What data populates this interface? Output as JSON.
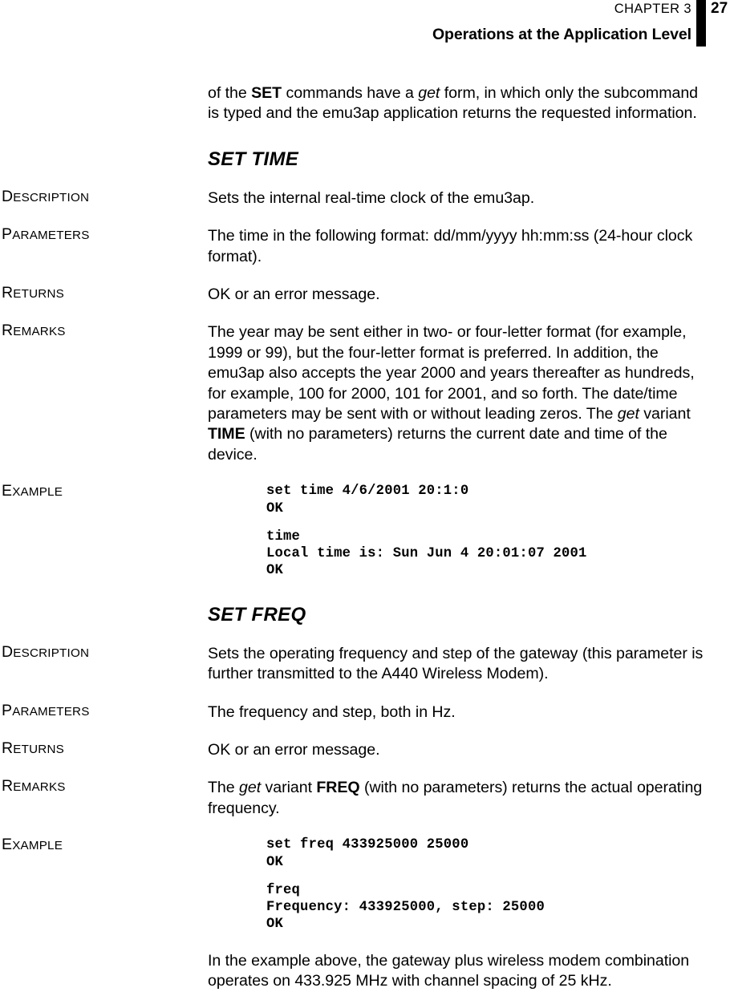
{
  "header": {
    "chapter_label": "CHAPTER 3",
    "page_number": "27",
    "running_title": "Operations at the Application Level"
  },
  "intro": {
    "text": "of the SET commands have a get form, in which only the subcommand is typed and the emu3ap application returns the requested information.",
    "segments": [
      {
        "text": "of the ",
        "style": "normal"
      },
      {
        "text": "SET",
        "style": "bold"
      },
      {
        "text": " commands have a ",
        "style": "normal"
      },
      {
        "text": "get",
        "style": "italic"
      },
      {
        "text": " form, in which only the subcommand is typed and the emu3ap application returns the requested information.",
        "style": "normal"
      }
    ]
  },
  "sections": [
    {
      "heading": "SET TIME",
      "labels": {
        "description": {
          "cap": "D",
          "rest": "ESCRIPTION"
        },
        "parameters": {
          "cap": "P",
          "rest": "ARAMETERS"
        },
        "returns": {
          "cap": "R",
          "rest": "ETURNS"
        },
        "remarks": {
          "cap": "R",
          "rest": "EMARKS"
        },
        "example": {
          "cap": "E",
          "rest": "XAMPLE"
        }
      },
      "description": "Sets the internal real-time clock of the emu3ap.",
      "parameters": "The time in the following format: dd/mm/yyyy hh:mm:ss (24-hour clock format).",
      "returns": "OK or an error message.",
      "remarks_part1": "The year may be sent either in two- or four-letter format (for example, 1999 or 99), but the four-letter format is preferred. In addition, the emu3ap also accepts the year 2000 and years thereafter as hundreds, for example, 100 for 2000, 101 for 2001, and so forth. The date/time parameters may be sent with or without leading zeros. The ",
      "remarks_italic": "get",
      "remarks_part2": " variant ",
      "remarks_bold": "TIME",
      "remarks_part3": " (with no parameters) returns the current date and time of the device.",
      "example_block_1": "set time 4/6/2001 20:1:0\nOK",
      "example_block_2": "time\nLocal time is: Sun Jun 4 20:01:07 2001\nOK"
    },
    {
      "heading": "SET FREQ",
      "labels": {
        "description": {
          "cap": "D",
          "rest": "ESCRIPTION"
        },
        "parameters": {
          "cap": "P",
          "rest": "ARAMETERS"
        },
        "returns": {
          "cap": "R",
          "rest": "ETURNS"
        },
        "remarks": {
          "cap": "R",
          "rest": "EMARKS"
        },
        "example": {
          "cap": "E",
          "rest": "XAMPLE"
        }
      },
      "description": "Sets the operating frequency and step of the gateway (this parameter is further transmitted to the A440 Wireless Modem).",
      "parameters": "The frequency and step, both in Hz.",
      "returns": "OK or an error message.",
      "remarks_part1": "The ",
      "remarks_italic": "get",
      "remarks_part2": " variant ",
      "remarks_bold": "FREQ",
      "remarks_part3": " (with no parameters) returns the actual operating frequency.",
      "example_block_1": "set freq 433925000 25000\nOK",
      "example_block_2": "freq\nFrequency: 433925000, step: 25000\nOK"
    }
  ],
  "closing": "In the example above, the gateway plus wireless modem combination operates on 433.925 MHz with channel spacing of 25 kHz."
}
